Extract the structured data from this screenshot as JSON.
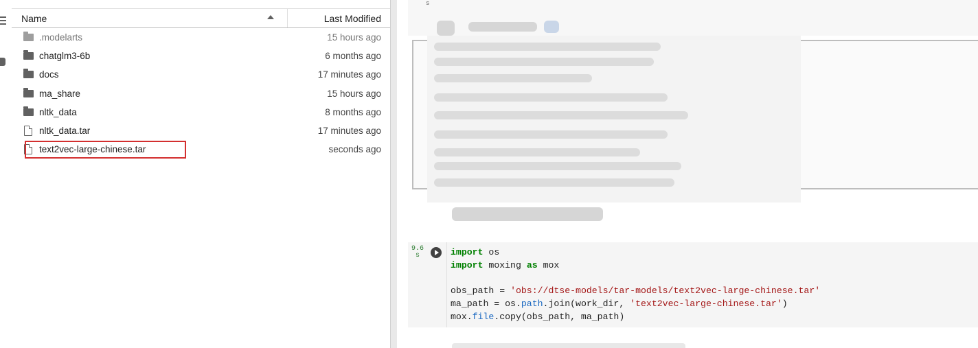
{
  "file_browser": {
    "header": {
      "name_label": "Name",
      "modified_label": "Last Modified"
    },
    "items": [
      {
        "name": ".modelarts",
        "modified": "15 hours ago",
        "kind": "folder"
      },
      {
        "name": "chatglm3-6b",
        "modified": "6 months ago",
        "kind": "folder"
      },
      {
        "name": "docs",
        "modified": "17 minutes ago",
        "kind": "folder"
      },
      {
        "name": "ma_share",
        "modified": "15 hours ago",
        "kind": "folder"
      },
      {
        "name": "nltk_data",
        "modified": "8 months ago",
        "kind": "folder"
      },
      {
        "name": "nltk_data.tar",
        "modified": "17 minutes ago",
        "kind": "file"
      },
      {
        "name": "text2vec-large-chinese.tar",
        "modified": "seconds ago",
        "kind": "file",
        "highlighted": true
      }
    ]
  },
  "notebook": {
    "top_cell_exec": "s",
    "code_cell": {
      "exec_time": "9.6",
      "exec_unit": "s",
      "code": {
        "kw_import": "import",
        "kw_as": "as",
        "mod_os": "os",
        "mod_moxing": "moxing",
        "alias_mox": "mox",
        "obs_assign": "obs_path = ",
        "obs_value": "'obs://dtse-models/tar-models/text2vec-large-chinese.tar'",
        "ma_assign": "ma_path = os.",
        "ma_attr_path": "path",
        "ma_join": ".join(work_dir, ",
        "ma_value": "'text2vec-large-chinese.tar'",
        "ma_close": ")",
        "mox_prefix": "mox.",
        "mox_attr_file": "file",
        "mox_rest": ".copy(obs_path, ma_path)"
      }
    }
  },
  "colors": {
    "highlight_border": "#d32f2f",
    "code_keyword": "#008000",
    "code_string": "#a31515",
    "exec_count": "#2e7d32"
  },
  "icons": [
    "menu-icon",
    "extension-icon",
    "folder-icon",
    "file-icon",
    "sort-ascending-icon",
    "run-icon"
  ]
}
